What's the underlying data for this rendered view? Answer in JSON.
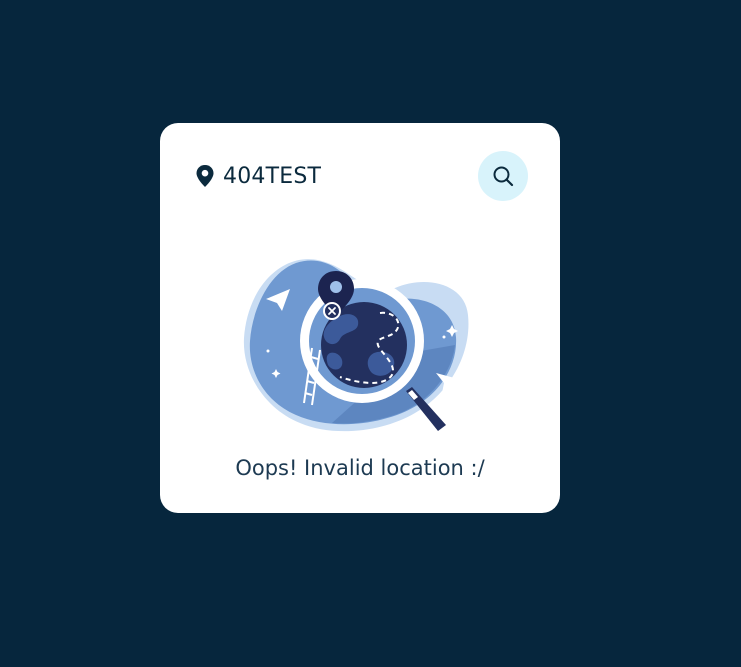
{
  "card": {
    "location_name": "404TEST",
    "location_icon": "map-pin-icon",
    "search_icon": "search-icon",
    "illustration": "globe-magnifier-not-found-illustration",
    "message": "Oops! Invalid location :/"
  },
  "colors": {
    "background": "#06263d",
    "card": "#ffffff",
    "search_button_bg": "#d8f3fb",
    "text_dark": "#0b2a3d",
    "illustration_blue": "#6f99d1",
    "illustration_navy": "#23305f"
  }
}
